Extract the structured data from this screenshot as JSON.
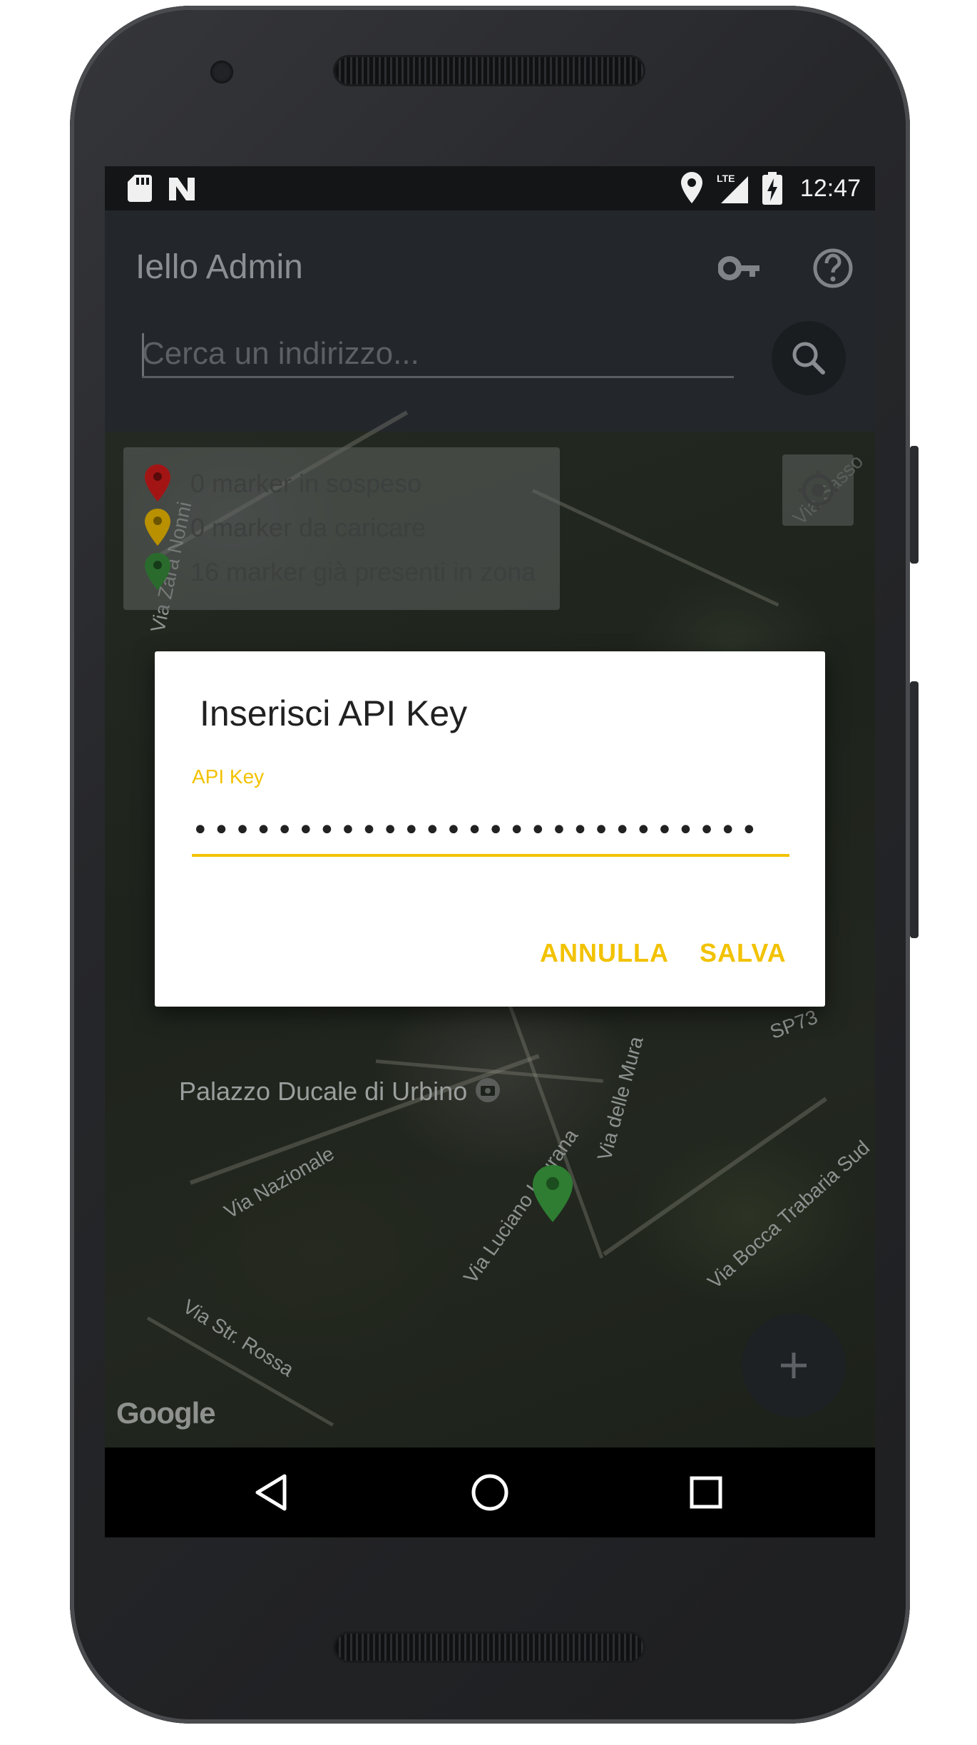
{
  "status_bar": {
    "time": "12:47",
    "network": "LTE"
  },
  "app_bar": {
    "title": "Iello Admin",
    "key_icon": "key-icon",
    "help_icon": "help-circle-icon"
  },
  "search": {
    "placeholder": "Cerca un indirizzo...",
    "value": ""
  },
  "legend": [
    {
      "text": "0 marker in sospeso",
      "color": "#b71c1c"
    },
    {
      "text": "0 marker da caricare",
      "color": "#c9a000"
    },
    {
      "text": "16 marker già presenti in zona",
      "color": "#2e7d32"
    }
  ],
  "map": {
    "labels": {
      "via_zara_nonni": "Via Zara Nonni",
      "palazzo": "Palazzo Ducale di Urbino",
      "via_nazionale": "Via Nazionale",
      "via_luciano_laurana": "Via Luciano Laurana",
      "via_delle_mura": "Via delle Mura",
      "via_bocca_trabaria": "Via Bocca Trabaria Sud",
      "via_str_rossa": "Via Str. Rossa",
      "sp73": "SP73",
      "via_sasso": "Via Sasso"
    },
    "attribution": "Google"
  },
  "dialog": {
    "title": "Inserisci API Key",
    "field_label": "API Key",
    "field_value": "•••••••••••••••••••••••••••",
    "cancel_label": "ANNULLA",
    "save_label": "SALVA",
    "accent_color": "#f2c200"
  },
  "fab": {
    "icon": "plus-icon"
  },
  "nav_bar": {
    "back": "back-triangle-icon",
    "home": "home-circle-icon",
    "recents": "recents-square-icon"
  }
}
